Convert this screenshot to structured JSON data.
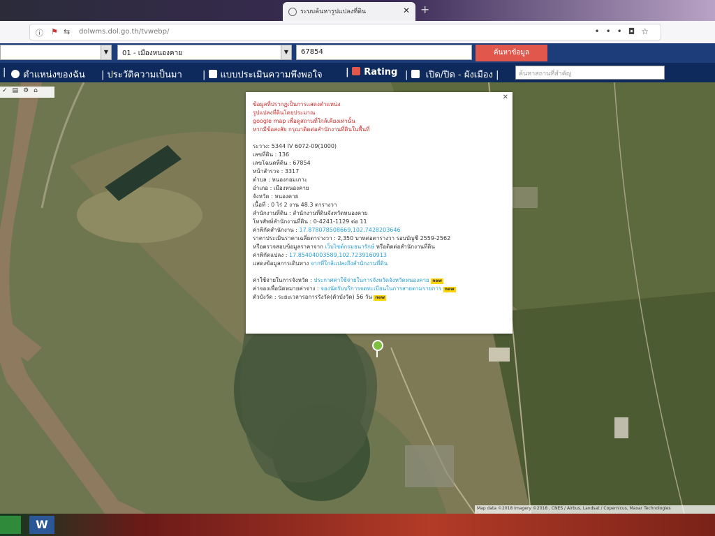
{
  "browser": {
    "tab_title": "ระบบค้นหารูปแปลงที่ดิน",
    "url": "dolwms.dol.go.th/tvwebp/"
  },
  "form": {
    "province_value": "",
    "amphoe_value": "01 - เมืองหนองคาย",
    "parcel_no_value": "67854",
    "search_label": "ค้นหาข้อมูล"
  },
  "menu": {
    "item1": "ตำแหน่งของฉัน",
    "item2": "ประวัติความเป็นมา",
    "item3": "แบบประเมินความพึงพอใจ",
    "item4": "Rating",
    "item5": "เปิด/ปิด - ผังเมือง",
    "search_placeholder": "ค้นหาสถานที่สำคัญ"
  },
  "popup": {
    "notice1": "ข้อมูลที่ปรากฏเป็นการแสดงตำแหน่ง",
    "notice2": "รูปแปลงที่ดินโดยประมาณ",
    "notice3": "google map เพื่อดูสถานที่ใกล้เคียงเท่านั้น",
    "notice4": "หากมีข้อสงสัย กรุณาติดต่อสำนักงานที่ดินในพื้นที่",
    "rows": [
      "ระวาง: 5344 IV 6072-09(1000)",
      "เลขที่ดิน : 136",
      "เลขโฉนดที่ดิน : 67854",
      "หน้าสำรวจ : 3317",
      "ตำบล : หนองกอมเกาะ",
      "อำเภอ : เมืองหนองคาย",
      "จังหวัด : หนองคาย",
      "เนื้อที่ : 0 ไร่ 2 งาน 48.3 ตารางวา",
      "สำนักงานที่ดิน : สำนักงานที่ดินจังหวัดหนองคาย",
      "โทรศัพท์สำนักงานที่ดิน : 0-4241-1129 ต่อ 11"
    ],
    "office_coord_label": "ค่าพิกัดสำนักงาน :",
    "office_coord_value": "17.878078508669,102.7428203646",
    "price_text": "ราคาประเมินราคาเฉลี่ยตารางวา : 2,350 บาทต่อตารางวา รอบบัญชี 2559-2562",
    "check_prefix": "หรือตรวจสอบข้อมูลราคาจาก",
    "check_link": "เว็บไซต์กรมธนารักษ์",
    "check_suffix": "หรือติดต่อสำนักงานที่ดิน",
    "parcel_coord_label": "ค่าพิกัดแปลง :",
    "parcel_coord_value": "17.85404003589,102.7239160913",
    "service_prefix": "แสดงข้อมูลการเดินทาง",
    "service_link": "จากที่ใกล้แปลงถึงสำนักงานที่ดิน",
    "fee_label": "ค่าใช้จ่ายในการจังหวัด :",
    "fee_link": "ประกาศค่าใช้จ่ายในการจังหวัดจังหวัดหนองคาย",
    "queue_label": "ค่าจองเพื่อนัดหมายค่าจาง :",
    "queue_link": "จองนัดรับบริการจดทะเบียนในการสายตามรายการ",
    "duration_label": "ตัวบังวัด :",
    "duration_value": "ระยะเวลารอการรังวัด(ตัวบังวัด) 56 วัน",
    "new_badge": "new"
  },
  "map": {
    "attribution": "Map data ©2018 Imagery ©2018 , CNES / Airbus, Landsat / Copernicus, Maxar Technologies"
  },
  "taskbar": {
    "word_label": "W"
  },
  "colors": {
    "navy": "#0e2a5c",
    "search_red": "#e2574c",
    "river": "#8d7a5f",
    "pin": "#7fbf3f"
  }
}
